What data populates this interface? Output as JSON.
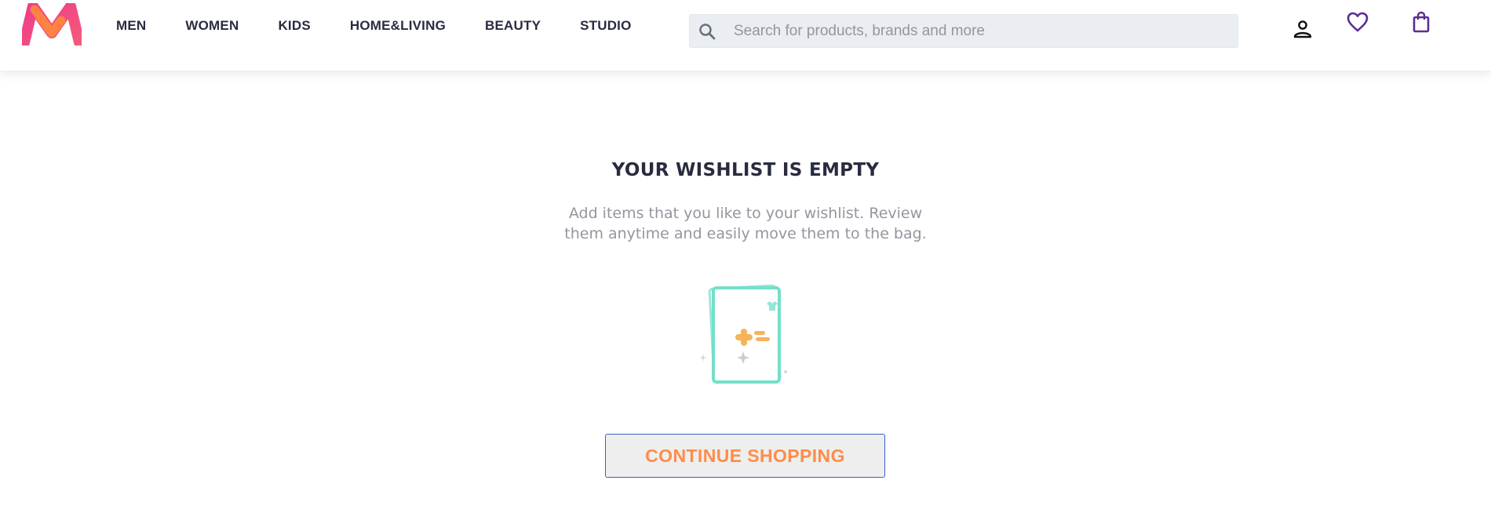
{
  "header": {
    "menu": [
      {
        "label": "MEN"
      },
      {
        "label": "WOMEN"
      },
      {
        "label": "KIDS"
      },
      {
        "label": "HOME&LIVING"
      },
      {
        "label": "BEAUTY"
      },
      {
        "label": "STUDIO"
      }
    ],
    "search": {
      "placeholder": "Search for products, brands and more",
      "value": ""
    },
    "icons": {
      "logo": "myntra-logo",
      "search": "search-icon",
      "profile": "profile-icon",
      "wishlist": "heart-icon",
      "bag": "bag-icon"
    },
    "colors": {
      "accent": "#5b2d90",
      "logo_pink": "#ee3c8b",
      "logo_orange": "#ff8a3c"
    }
  },
  "main": {
    "title": "YOUR WISHLIST IS EMPTY",
    "description": "Add items that you like to your wishlist. Review them anytime and easily move them to the bag.",
    "illustration": "empty-wishlist-illustration",
    "continue_label": "CONTINUE SHOPPING",
    "colors": {
      "button_text": "#ff8c4a",
      "button_border": "#3a5fcd",
      "illustration": "#7fe0cd"
    }
  }
}
